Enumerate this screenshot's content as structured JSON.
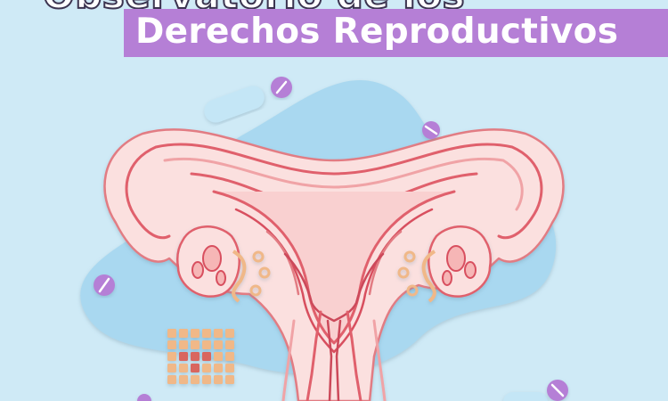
{
  "title": {
    "line1": "Observatorio de los",
    "line2": "Derechos Reproductivos"
  },
  "colors": {
    "background": "#cfeaf6",
    "blob": "#a9d8f0",
    "band": "#b57fd6",
    "uterus_line": "#e0606c",
    "uterus_fill": "#f6c3c4",
    "pill": "#b57fd6",
    "calendar_cell": "#f0b888",
    "calendar_marked": "#d9665f"
  },
  "illustration": {
    "pill_icons": 6,
    "calendar": {
      "rows": 5,
      "cols": 6,
      "marked_cells": [
        [
          2,
          1
        ],
        [
          2,
          2
        ],
        [
          2,
          3
        ],
        [
          3,
          2
        ]
      ]
    }
  }
}
